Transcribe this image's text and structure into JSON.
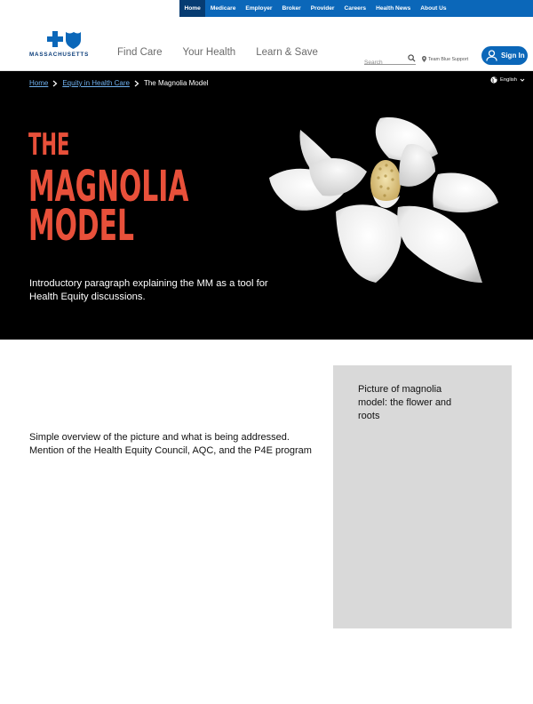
{
  "utility_nav": {
    "items": [
      "Home",
      "Medicare",
      "Employer",
      "Broker",
      "Provider",
      "Careers",
      "Health News",
      "About Us"
    ],
    "active": "Home"
  },
  "header": {
    "logo_text": "MASSACHUSETTS",
    "nav": [
      "Find Care",
      "Your Health",
      "Learn & Save"
    ],
    "search_placeholder": "Search",
    "support_label": "Team Blue Support",
    "signin_label": "Sign In"
  },
  "hero": {
    "breadcrumb": [
      "Home",
      "Equity in Health Care",
      "The Magnolia Model"
    ],
    "language": "English",
    "title_lines": [
      "THE",
      "MAGNOLIA",
      "MODEL"
    ],
    "intro": "Introductory paragraph explaining the MM as a tool for Health Equity discussions."
  },
  "body": {
    "overview": "Simple overview of the picture and what is being addressed. Mention of the Health Equity Council, AQC, and the P4E program",
    "image_placeholder": "Picture of magnolia model: the flower and roots"
  },
  "colors": {
    "brand_blue": "#0b67b9",
    "utility_active": "#063c72",
    "title_orange": "#e8503a",
    "hero_bg": "#000000",
    "placeholder_gray": "#d9d9d9"
  },
  "icons": [
    "bcbs-logo-icon",
    "search-icon",
    "location-pin-icon",
    "user-icon",
    "globe-icon",
    "chevron-down-icon",
    "chevron-right-icon"
  ]
}
